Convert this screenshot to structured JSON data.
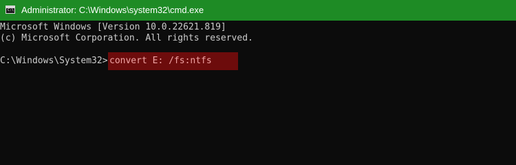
{
  "window": {
    "title": "Administrator: C:\\Windows\\system32\\cmd.exe",
    "icon": "cmd-icon",
    "titlebar_color": "#1e8b25"
  },
  "console": {
    "lines": [
      "Microsoft Windows [Version 10.0.22621.819]",
      "(c) Microsoft Corporation. All rights reserved."
    ],
    "prompt": "C:\\Windows\\System32>",
    "command": "convert E: /fs:ntfs",
    "highlight_color": "#6d0c0c"
  }
}
